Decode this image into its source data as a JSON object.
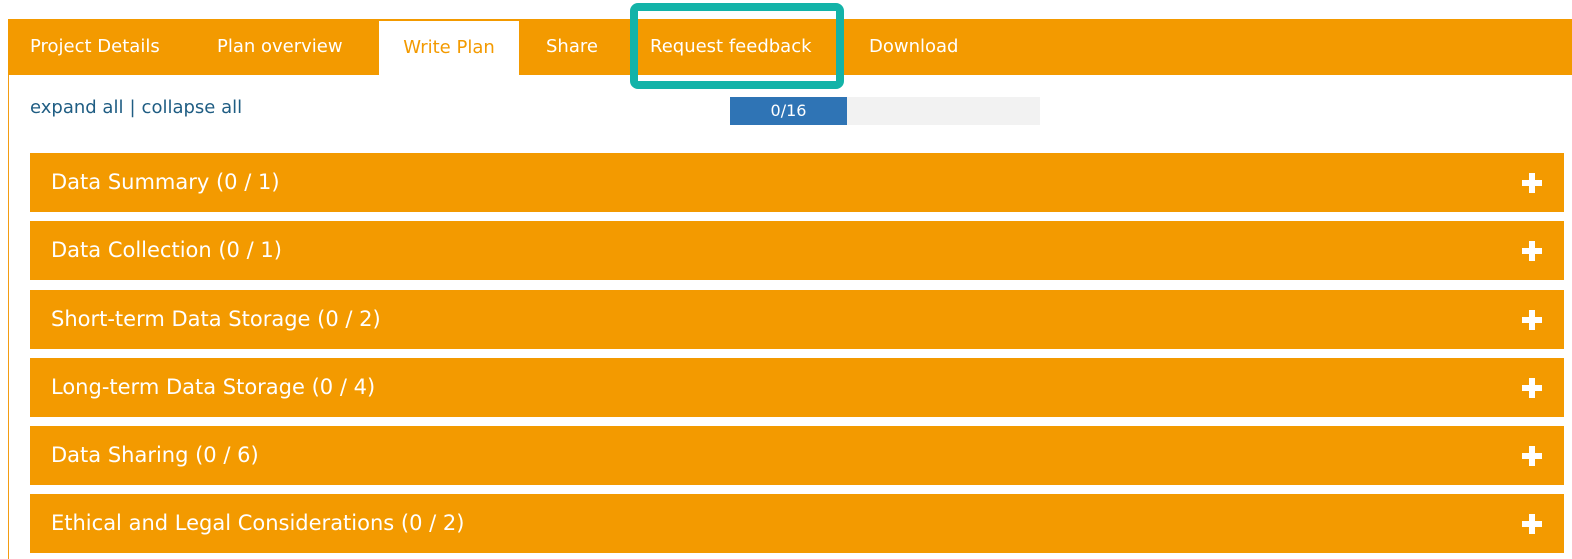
{
  "tabs": [
    {
      "label": "Project Details"
    },
    {
      "label": "Plan overview"
    },
    {
      "label": "Write Plan"
    },
    {
      "label": "Share"
    },
    {
      "label": "Request feedback"
    },
    {
      "label": "Download"
    }
  ],
  "active_tab": "Write Plan",
  "highlighted_tab": "Request feedback",
  "controls": {
    "expand_label": "expand all",
    "separator": "|",
    "collapse_label": "collapse all"
  },
  "progress": {
    "label": "0/16",
    "answered": 0,
    "total": 16
  },
  "sections": [
    {
      "title": "Data Summary (0 / 1)"
    },
    {
      "title": "Data Collection (0 / 1)"
    },
    {
      "title": "Short-term Data Storage (0 / 2)"
    },
    {
      "title": "Long-term Data Storage (0 / 4)"
    },
    {
      "title": "Data Sharing (0 / 6)"
    },
    {
      "title": "Ethical and Legal Considerations (0 / 2)"
    }
  ],
  "icons": {
    "section_toggle": "plus-icon"
  },
  "colors": {
    "accent": "#f39a00",
    "highlight": "#13b3a8",
    "link": "#1f5d83",
    "progress_fill": "#2f74b5",
    "progress_track": "#f2f2f2"
  }
}
